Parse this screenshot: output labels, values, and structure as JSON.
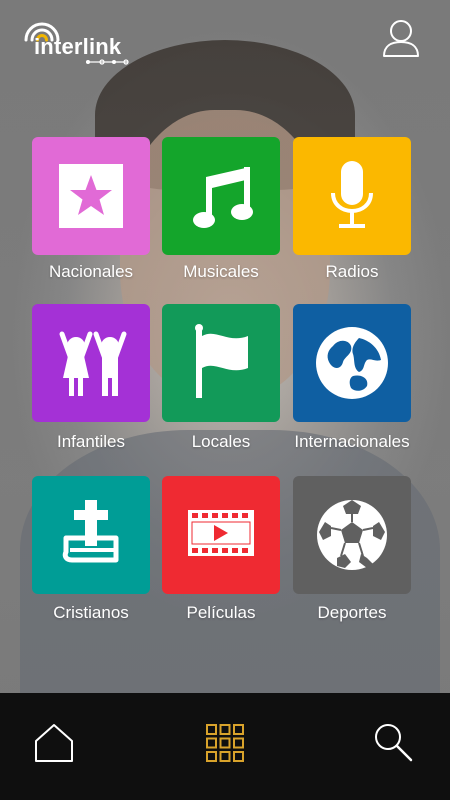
{
  "app": {
    "brand": "interlink"
  },
  "categories": [
    {
      "label": "Nacionales",
      "color": "#e16ad6",
      "icon": "star-icon"
    },
    {
      "label": "Musicales",
      "color": "#14a52b",
      "icon": "music-note-icon"
    },
    {
      "label": "Radios",
      "color": "#fbb800",
      "icon": "microphone-icon"
    },
    {
      "label": "Infantiles",
      "color": "#a431d6",
      "icon": "children-icon"
    },
    {
      "label": "Locales",
      "color": "#129a59",
      "icon": "flag-icon"
    },
    {
      "label": "Internacionales",
      "color": "#0f5fa2",
      "icon": "globe-icon"
    },
    {
      "label": "Cristianos",
      "color": "#009d96",
      "icon": "bible-cross-icon"
    },
    {
      "label": "Películas",
      "color": "#ef2a32",
      "icon": "film-play-icon"
    },
    {
      "label": "Deportes",
      "color": "#606060",
      "icon": "soccer-ball-icon"
    }
  ],
  "bottom_nav": [
    {
      "icon": "home-icon"
    },
    {
      "icon": "grid-icon",
      "active": true,
      "active_color": "#d9a32b"
    },
    {
      "icon": "search-icon"
    }
  ]
}
